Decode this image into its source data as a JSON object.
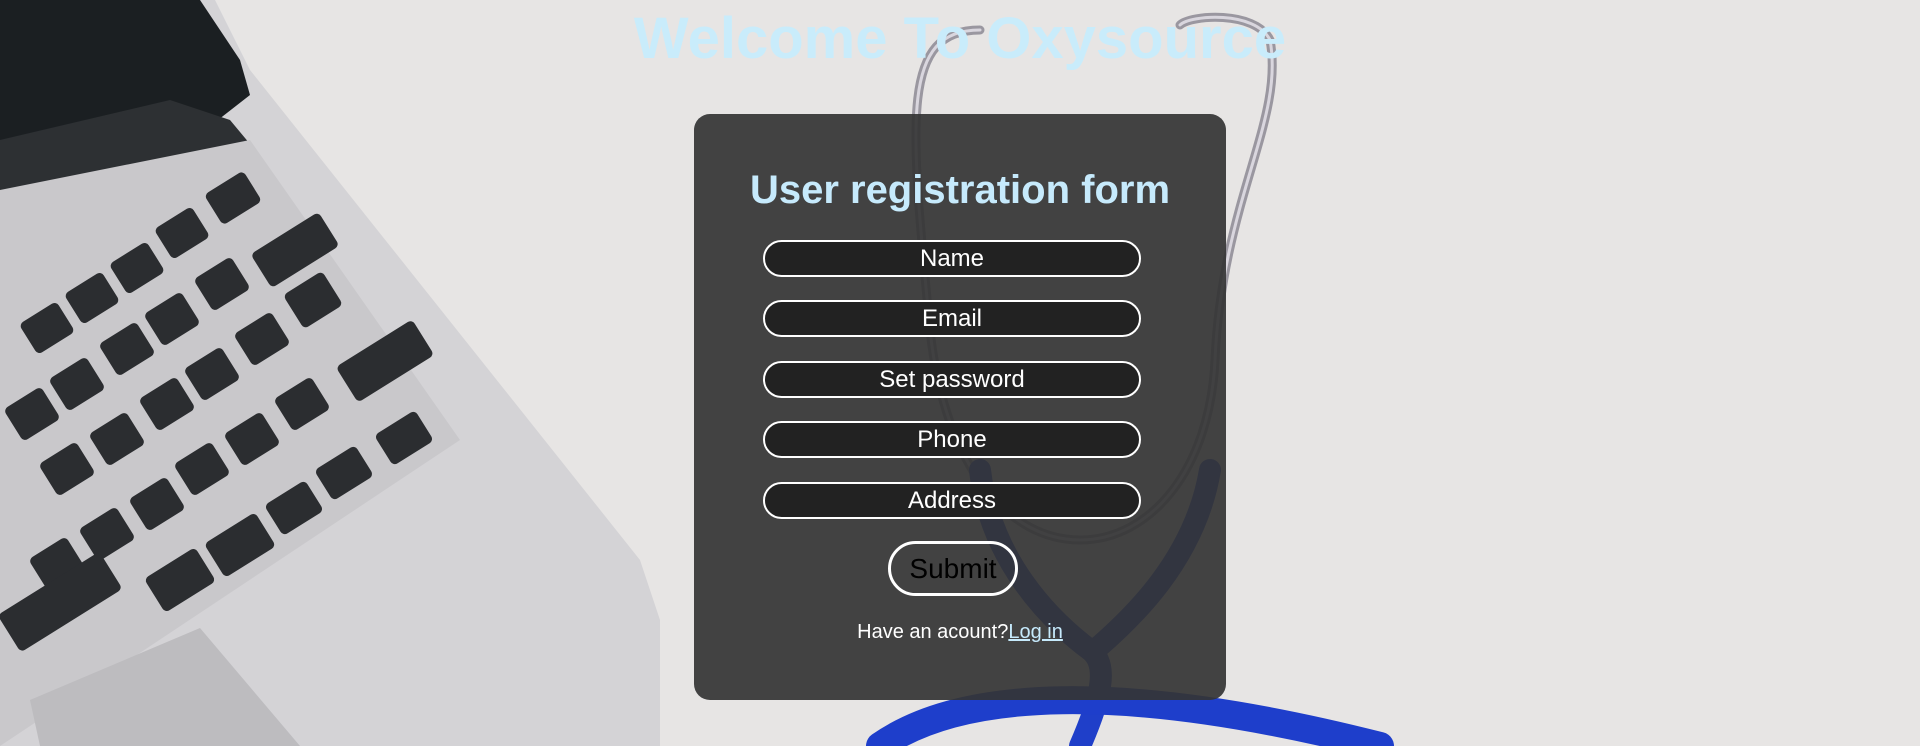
{
  "page": {
    "heading": "Welcome To Oxysource"
  },
  "form": {
    "title": "User registration form",
    "fields": {
      "name": {
        "placeholder": "Name"
      },
      "email": {
        "placeholder": "Email"
      },
      "password": {
        "placeholder": "Set password"
      },
      "phone": {
        "placeholder": "Phone"
      },
      "address": {
        "placeholder": "Address"
      }
    },
    "submit_label": "Submit",
    "account_prompt": "Have an acount?",
    "login_link": "Log in"
  },
  "colors": {
    "heading": "#c9ecfb",
    "card_background": "#343434",
    "field_background": "#222222",
    "link": "#c6eafc"
  }
}
